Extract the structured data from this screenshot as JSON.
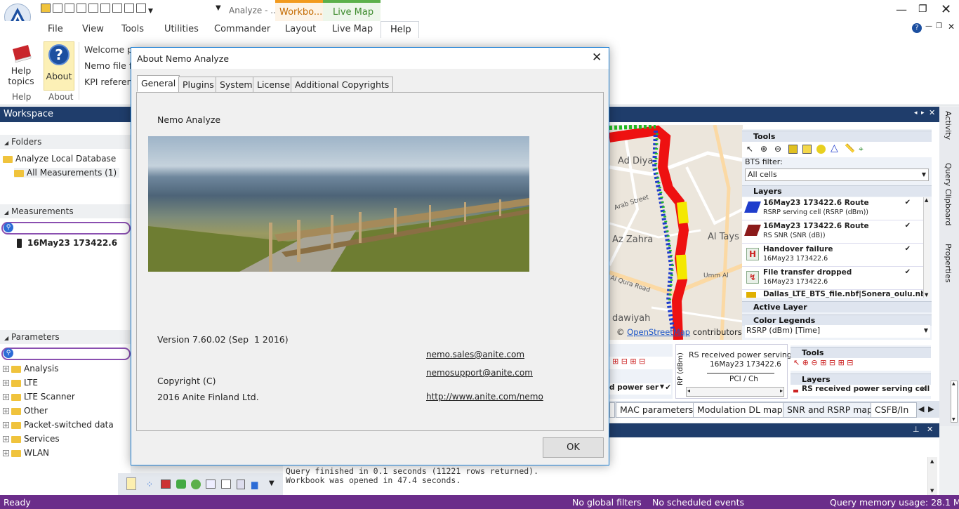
{
  "app": {
    "title_short": "Analyze - ...",
    "context_tab_workbook": "Workbo...",
    "context_tab_livemap": "Live Map",
    "menu": [
      "File",
      "View",
      "Tools",
      "Utilities",
      "Commander",
      "Layout",
      "Live Map",
      "Help"
    ]
  },
  "ribbon": {
    "help_topics": "Help topics",
    "about": "About",
    "group_help": "Help",
    "group_about": "About",
    "links": [
      "Welcome p",
      "Nemo file f",
      "KPI referen"
    ]
  },
  "workspace": {
    "title": "Workspace",
    "folders_title": "Folders",
    "folders": [
      "Analyze Local Database",
      "All Measurements (1)"
    ],
    "measurements_title": "Measurements",
    "measurement_item": "16May23 173422.6",
    "parameters_title": "Parameters",
    "parameters": [
      "Analysis",
      "LTE",
      "LTE Scanner",
      "Other",
      "Packet-switched data",
      "Services",
      "WLAN"
    ]
  },
  "dialog": {
    "title": "About Nemo Analyze",
    "tabs": [
      "General",
      "Plugins",
      "System",
      "License",
      "Additional Copyrights"
    ],
    "product": "Nemo Analyze",
    "version": "Version 7.60.02 (Sep  1 2016)",
    "email_sales": "nemo.sales@anite.com",
    "email_support": "nemosupport@anite.com",
    "copyright_line1": "Copyright (C)",
    "copyright_line2": "2016 Anite Finland Ltd.",
    "url": "http://www.anite.com/nemo",
    "ok": "OK"
  },
  "map": {
    "labels": [
      "Ad Diya",
      "Arab Street",
      "Az Zahra",
      "Al Tays",
      "Umm Al",
      "Al Qura Road",
      "dawiyah"
    ],
    "attribution_prefix": "©",
    "attribution_link": "OpenStreetMap",
    "attribution_suffix": "contributors",
    "tools_title": "Tools",
    "bts_filter_label": "BTS filter:",
    "bts_filter_value": "All cells",
    "layers_title": "Layers",
    "layers": [
      {
        "name": "16May23 173422.6 Route",
        "sub": "RSRP serving cell (RSRP (dBm))",
        "color": "#1f3dcc"
      },
      {
        "name": "16May23 173422.6 Route",
        "sub": "RS SNR (SNR (dB))",
        "color": "#8b1a1a"
      },
      {
        "name": "Handover failure",
        "sub": "16May23 173422.6",
        "color": "#cc2222"
      },
      {
        "name": "File transfer dropped",
        "sub": "16May23 173422.6",
        "color": "#cc2222"
      },
      {
        "name": "Dallas_LTE_BTS_file.nbf|Sonera_oulu.nbf",
        "sub": "",
        "color": "#e0b000"
      }
    ],
    "active_layer_title": "Active Layer",
    "color_legends_title": "Color Legends",
    "color_legend_value": "RSRP (dBm) [Time]",
    "check": "✔"
  },
  "lower_panels": {
    "left_label": "d power ser",
    "chart_title": "RS received power serving",
    "chart_subtitle": "16May23 173422.6",
    "chart_yaxis": "RP (dBm)",
    "chart_xaxis": "PCI / Ch",
    "tools_title": "Tools",
    "layers_title": "Layers",
    "layer_item": "RS received power serving cell"
  },
  "bottom_tabs": [
    "MAC parameters",
    "Modulation DL map",
    "SNR and RSRP map",
    "CSFB/In"
  ],
  "right_tabs": [
    "Activity",
    "Query Clipboard",
    "Properties"
  ],
  "output": {
    "lines": [
      "Query finished in 0.1 seconds (11221 rows returned).",
      "Workbook was opened in 47.4 seconds."
    ]
  },
  "status": {
    "ready": "Ready",
    "filters": "No global filters",
    "events": "No scheduled events",
    "memory": "Query memory usage: 28.1 M"
  },
  "colors": {
    "accent_purple": "#6b2d8a",
    "workspace_header": "#1f3d6b",
    "route_red": "#ee1111",
    "route_yellow": "#f4e800",
    "route_green": "#22bb22",
    "route_blue": "#1f3dcc"
  }
}
